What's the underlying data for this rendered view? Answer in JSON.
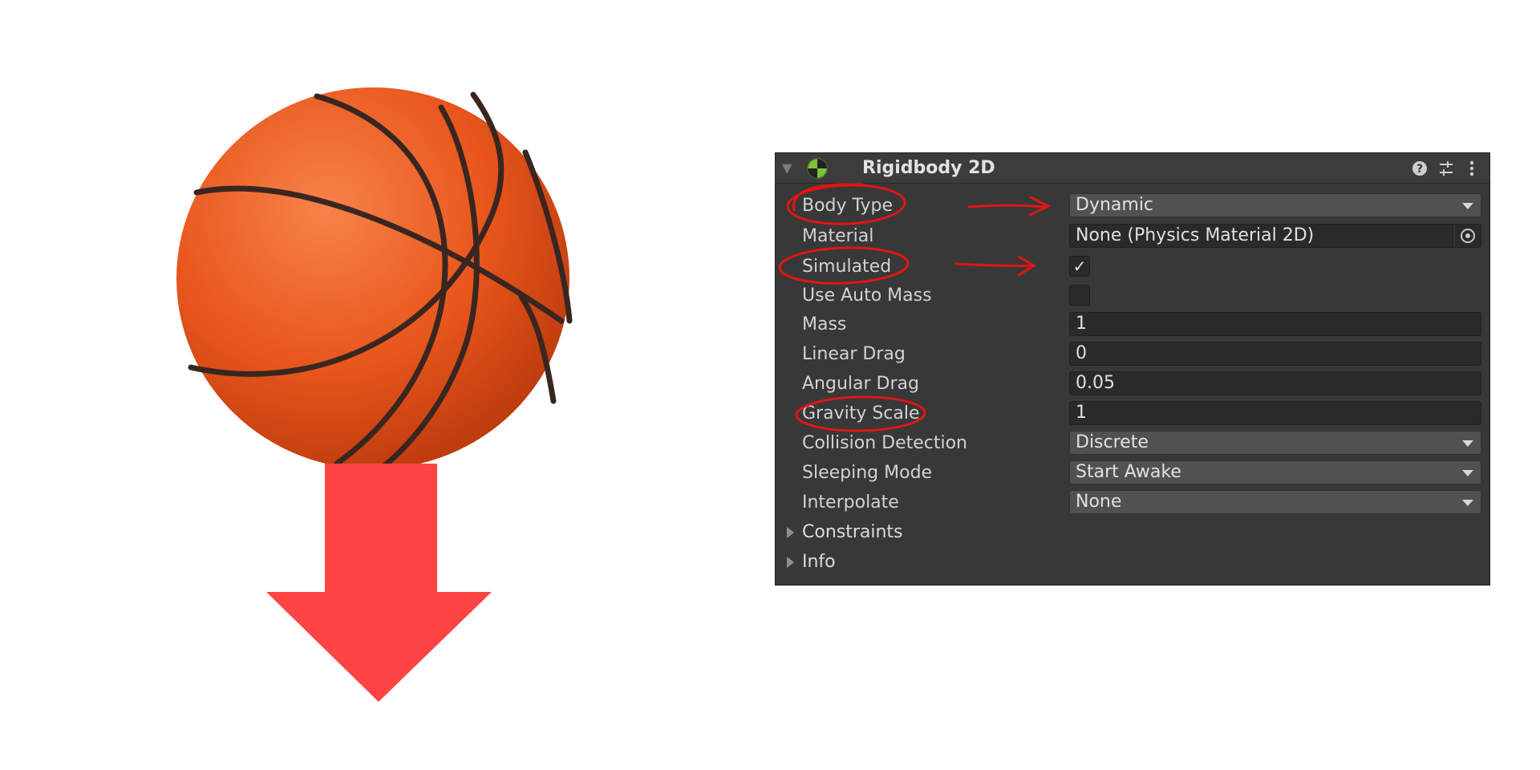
{
  "illustration": {
    "ball_icon": "basketball-image",
    "arrow_icon": "down-arrow",
    "arrow_color": "#ff4444",
    "ball_color": "#e8561c"
  },
  "inspector": {
    "component_title": "Rigidbody 2D",
    "header_icons": [
      "help-icon",
      "presets-icon",
      "more-options-icon"
    ],
    "fields": {
      "body_type": {
        "label": "Body Type",
        "value": "Dynamic"
      },
      "material": {
        "label": "Material",
        "value": "None (Physics Material 2D)"
      },
      "simulated": {
        "label": "Simulated",
        "checked": true,
        "mark": "✓"
      },
      "use_auto_mass": {
        "label": "Use Auto Mass",
        "checked": false
      },
      "mass": {
        "label": "Mass",
        "value": "1"
      },
      "linear_drag": {
        "label": "Linear Drag",
        "value": "0"
      },
      "angular_drag": {
        "label": "Angular Drag",
        "value": "0.05"
      },
      "gravity_scale": {
        "label": "Gravity Scale",
        "value": "1"
      },
      "collision_detection": {
        "label": "Collision Detection",
        "value": "Discrete"
      },
      "sleeping_mode": {
        "label": "Sleeping Mode",
        "value": "Start Awake"
      },
      "interpolate": {
        "label": "Interpolate",
        "value": "None"
      }
    },
    "foldouts": {
      "constraints": "Constraints",
      "info": "Info"
    }
  },
  "annotations": {
    "color": "#e01515",
    "circled": [
      "Body Type",
      "Simulated",
      "Gravity Scale"
    ],
    "arrows_to": [
      "Dynamic",
      "Simulated checkbox"
    ]
  }
}
